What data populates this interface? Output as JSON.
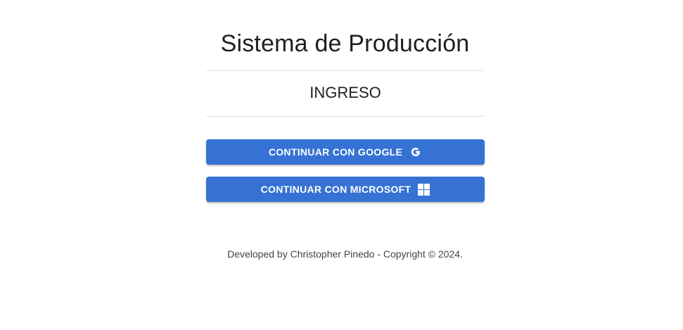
{
  "header": {
    "title": "Sistema de Producción",
    "subtitle": "INGRESO"
  },
  "login": {
    "google_label": "CONTINUAR CON GOOGLE",
    "google_icon": "google-icon",
    "microsoft_label": "CONTINUAR CON MICROSOFT",
    "microsoft_icon": "windows-icon",
    "button_color": "#3572d4"
  },
  "footer": {
    "text": "Developed by Christopher Pinedo - Copyright © 2024."
  }
}
